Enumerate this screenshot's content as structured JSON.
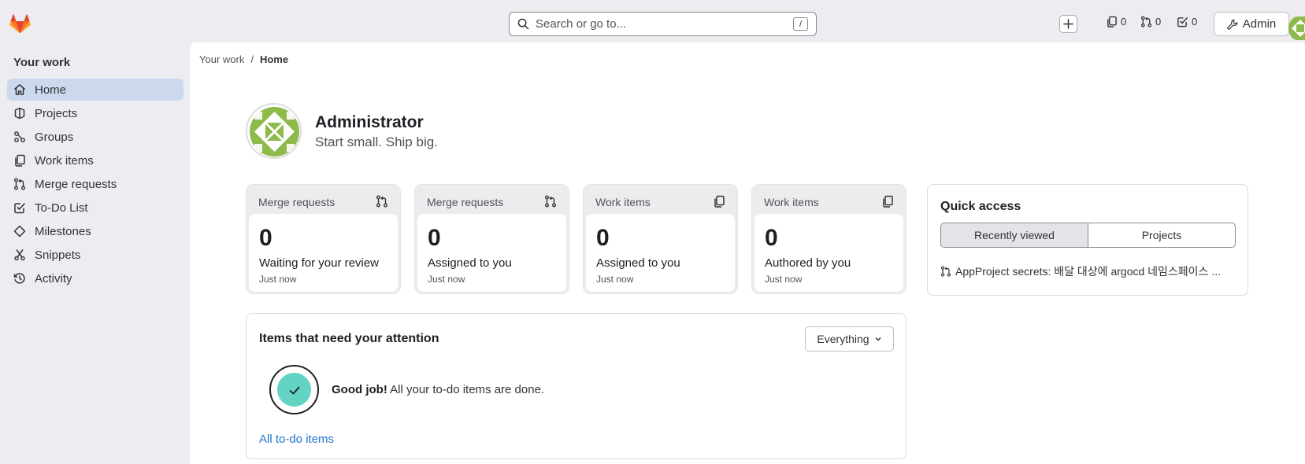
{
  "topbar": {
    "search_placeholder": "Search or go to...",
    "search_shortcut": "/",
    "issues_count": "0",
    "merge_requests_count": "0",
    "todos_count": "0",
    "admin_label": "Admin"
  },
  "sidebar": {
    "title": "Your work",
    "items": [
      {
        "label": "Home",
        "icon": "home-icon"
      },
      {
        "label": "Projects",
        "icon": "project-icon"
      },
      {
        "label": "Groups",
        "icon": "group-icon"
      },
      {
        "label": "Work items",
        "icon": "work-items-icon"
      },
      {
        "label": "Merge requests",
        "icon": "merge-request-icon"
      },
      {
        "label": "To-Do List",
        "icon": "todo-icon"
      },
      {
        "label": "Milestones",
        "icon": "milestone-icon"
      },
      {
        "label": "Snippets",
        "icon": "snippet-icon"
      },
      {
        "label": "Activity",
        "icon": "history-icon"
      }
    ]
  },
  "breadcrumb": {
    "parent": "Your work",
    "separator": "/",
    "current": "Home"
  },
  "profile": {
    "name": "Administrator",
    "tagline": "Start small. Ship big."
  },
  "stats": [
    {
      "header": "Merge requests",
      "value": "0",
      "label": "Waiting for your review",
      "time": "Just now"
    },
    {
      "header": "Merge requests",
      "value": "0",
      "label": "Assigned to you",
      "time": "Just now"
    },
    {
      "header": "Work items",
      "value": "0",
      "label": "Assigned to you",
      "time": "Just now"
    },
    {
      "header": "Work items",
      "value": "0",
      "label": "Authored by you",
      "time": "Just now"
    }
  ],
  "quick_access": {
    "title": "Quick access",
    "tabs": [
      "Recently viewed",
      "Projects"
    ],
    "items": [
      "AppProject secrets: 배달 대상에 argocd 네임스페이스 ..."
    ]
  },
  "attention": {
    "title": "Items that need your attention",
    "filter": "Everything",
    "message_bold": "Good job!",
    "message": "All your to-do items are done.",
    "link": "All to-do items"
  },
  "colors": {
    "active_nav": "#cbd8ed",
    "link": "#1f75cb",
    "success_badge": "#63d3c3",
    "avatar_green": "#8dba4a"
  }
}
